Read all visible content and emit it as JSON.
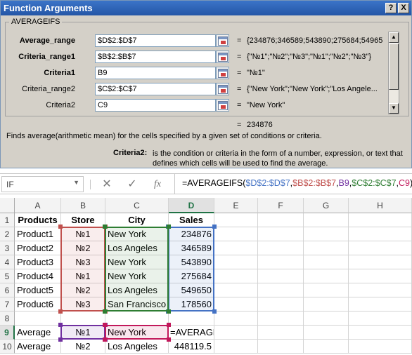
{
  "dialog": {
    "title": "Function Arguments",
    "help_button": "?",
    "close_button": "X",
    "function_name": "AVERAGEIFS",
    "args": [
      {
        "label": "Average_range",
        "bold": true,
        "value": "$D$2:$D$7",
        "preview": "{234876;346589;543890;275684;549650"
      },
      {
        "label": "Criteria_range1",
        "bold": true,
        "value": "$B$2:$B$7",
        "preview": "{\"№1\";\"№2\";\"№3\";\"№1\";\"№2\";\"№3\"}"
      },
      {
        "label": "Criteria1",
        "bold": true,
        "value": "B9",
        "preview": "\"№1\""
      },
      {
        "label": "Criteria_range2",
        "bold": false,
        "value": "$C$2:$C$7",
        "preview": "{\"New York\";\"New York\";\"Los Angele..."
      },
      {
        "label": "Criteria2",
        "bold": false,
        "value": "C9",
        "preview": "\"New York\""
      }
    ],
    "equals_sign": "=",
    "result_value": "234876",
    "description": "Finds average(arithmetic mean) for the cells specified by a given set of conditions or criteria.",
    "arg_help_name": "Criteria2:",
    "arg_help_text": "is the condition or criteria in the form of a number, expression, or text that defines which cells will be used to find the average."
  },
  "formula_bar": {
    "name_box": "IF",
    "name_box_arrow": "▼",
    "cancel_icon": "✕",
    "enter_icon": "✓",
    "fx_label": "fx",
    "formula_parts": [
      "=AVERAGEIFS(",
      "$D$2:$D$7",
      ",",
      "$B$2:$B$7",
      ",",
      "B9",
      ",",
      "$C$2:$C$7",
      ",",
      "C9",
      ")"
    ]
  },
  "grid": {
    "columns": [
      "A",
      "B",
      "C",
      "D",
      "E",
      "F",
      "G",
      "H"
    ],
    "active_column": "D",
    "rows": [
      "1",
      "2",
      "3",
      "4",
      "5",
      "6",
      "7",
      "8",
      "9",
      "10"
    ],
    "active_row": "9",
    "cells": [
      [
        "Products",
        "Store",
        "City",
        "Sales"
      ],
      [
        "Product1",
        "№1",
        "New York",
        "234876"
      ],
      [
        "Product2",
        "№2",
        "Los Angeles",
        "346589"
      ],
      [
        "Product3",
        "№3",
        "New York",
        "543890"
      ],
      [
        "Product4",
        "№1",
        "New York",
        "275684"
      ],
      [
        "Product5",
        "№2",
        "Los Angeles",
        "549650"
      ],
      [
        "Product6",
        "№3",
        "San Francisco",
        "178560"
      ],
      [
        "",
        "",
        "",
        ""
      ],
      [
        "Average",
        "№1",
        "New York",
        "=AVERAGEIFS"
      ],
      [
        "Average",
        "№2",
        "Los Angeles",
        "448119.5"
      ]
    ],
    "range_colors": {
      "average_range": "#4472c4",
      "criteria_range1": "#c0504d",
      "criteria1": "#7030a0",
      "criteria_range2": "#2e7d32",
      "criteria2": "#c2185b"
    }
  }
}
